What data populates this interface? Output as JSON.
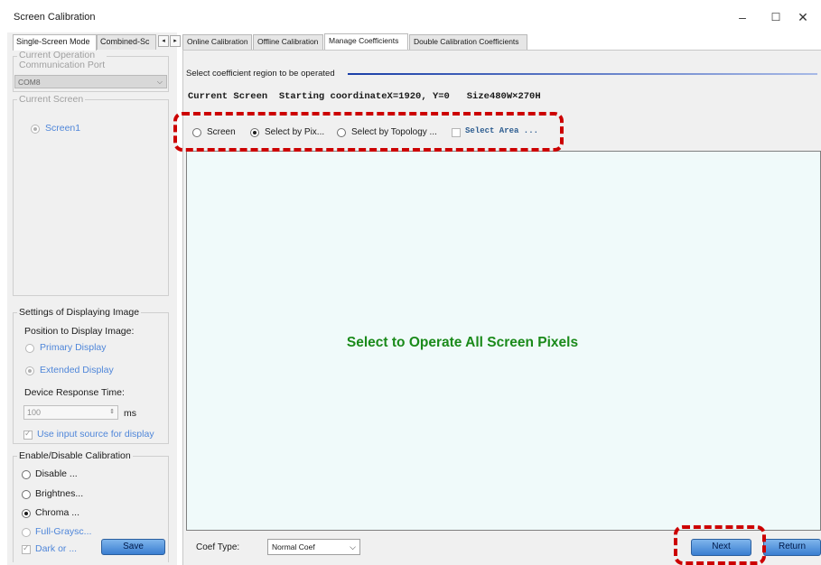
{
  "window": {
    "title": "Screen Calibration",
    "minimize": "–",
    "maximize": "☐",
    "close": "✕"
  },
  "left": {
    "tabs": [
      "Single-Screen Mode",
      "Combined-Sc"
    ],
    "tab_scroll_left": "◂",
    "tab_scroll_right": "▸",
    "current_operation": {
      "legend_line1": "Current Operation",
      "legend_line2": "Communication Port",
      "port_value": "COM8"
    },
    "current_screen": {
      "legend": "Current Screen",
      "screen_item": "Screen1"
    },
    "display_settings": {
      "legend": "Settings of Displaying Image",
      "position_label": "Position to Display Image:",
      "primary": "Primary Display",
      "extended": "Extended Display",
      "response_label": "Device Response Time:",
      "response_value": "100",
      "response_unit": "ms",
      "use_input": "Use input source for display"
    },
    "calibration": {
      "legend": "Enable/Disable Calibration",
      "disable": "Disable ...",
      "brightness": "Brightnes...",
      "chroma": "Chroma ...",
      "full_grayscale": "Full-Graysc...",
      "dark_or": "Dark or ...",
      "save": "Save"
    }
  },
  "right": {
    "tabs": [
      "Online Calibration",
      "Offline Calibration",
      "Manage Coefficients",
      "Double Calibration Coefficients"
    ],
    "active_tab": "Manage Coefficients",
    "region_label": "Select coefficient region to be operated",
    "current_screen_info": "Current Screen  Starting coordinateX=1920, Y=0   Size480W×270H",
    "options": {
      "screen": "Screen",
      "select_by_pixel": "Select by Pix...",
      "select_by_topology": "Select by Topology ...",
      "select_area": "Select Area ..."
    },
    "canvas_message": "Select to Operate All Screen Pixels",
    "coef_type_label": "Coef Type:",
    "coef_type_value": "Normal Coef",
    "next": "Next",
    "return": "Return"
  },
  "colors": {
    "accent_button": "#3a7ed1",
    "highlight_dash": "#cc0000",
    "canvas_text": "#1a8a1a",
    "canvas_bg": "#f0fafa"
  }
}
